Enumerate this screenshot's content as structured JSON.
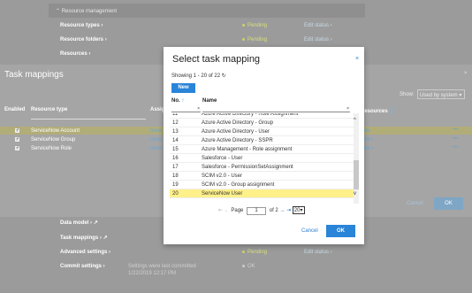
{
  "background": {
    "resource_management_label": "Resource management",
    "rows_top": [
      {
        "label": "Resource types",
        "status": "Pending",
        "edit": "Edit status"
      },
      {
        "label": "Resource folders",
        "status": "Pending",
        "edit": "Edit status"
      },
      {
        "label": "Resources"
      }
    ],
    "rows_bottom": [
      {
        "label": "Data model"
      },
      {
        "label": "Task mappings"
      },
      {
        "label": "Advanced settings",
        "status": "Pending",
        "edit": "Edit status"
      },
      {
        "label": "Commit settings",
        "note_line1": "Settings were last committed",
        "note_line2": "1/22/2019 12:17 PM",
        "status": "OK"
      }
    ]
  },
  "task_mappings": {
    "title": "Task mappings",
    "show_label": "Show:",
    "show_value": "Used by system",
    "headers": {
      "enabled": "Enabled",
      "resource_type": "Resource type",
      "assign": "Assig",
      "resources": "resources"
    },
    "rows": [
      {
        "name": "ServiceNow Account",
        "assign": "none",
        "res": "ne"
      },
      {
        "name": "ServiceNow Group",
        "assign": "none",
        "res": "ne"
      },
      {
        "name": "ServiceNow Role",
        "assign": "none",
        "res": "ne"
      }
    ],
    "cancel": "Cancel",
    "ok": "OK"
  },
  "modal": {
    "title": "Select task mapping",
    "showing": "Showing 1 - 20 of 22",
    "new_label": "New",
    "col_no": "No.",
    "col_name": "Name",
    "items": [
      {
        "no": "11",
        "name": "Azure Active Directory - Role Assignment"
      },
      {
        "no": "12",
        "name": "Azure Active Directory - Group"
      },
      {
        "no": "13",
        "name": "Azure Active Directory - User"
      },
      {
        "no": "14",
        "name": "Azure Active Directory - SSPR"
      },
      {
        "no": "15",
        "name": "Azure Management - Role assignment"
      },
      {
        "no": "16",
        "name": "Salesforce - User"
      },
      {
        "no": "17",
        "name": "Salesforce - PermissionSetAssignment"
      },
      {
        "no": "18",
        "name": "SCIM v2.0 - User"
      },
      {
        "no": "19",
        "name": "SCIM v2.0 - Group assignment"
      },
      {
        "no": "20",
        "name": "ServiceNow User"
      }
    ],
    "pager": {
      "page_label": "Page",
      "page": "1",
      "of": "of 2",
      "page_size": "20"
    },
    "cancel": "Cancel",
    "ok": "OK"
  }
}
